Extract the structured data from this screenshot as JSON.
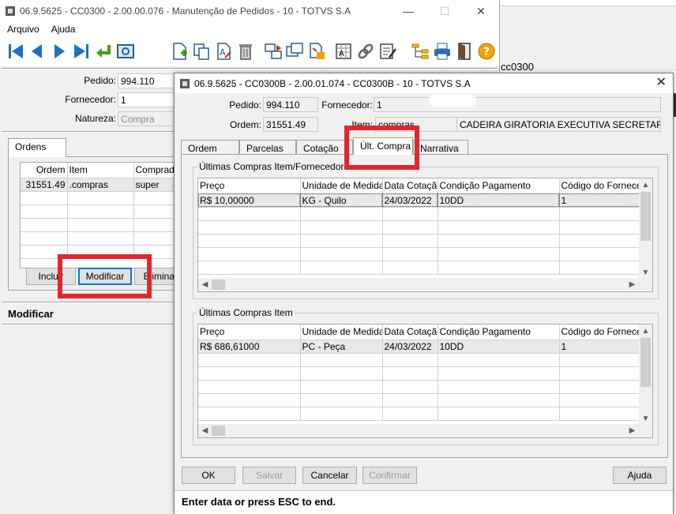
{
  "background_window": {
    "title": "06.9.5625 - CC0300 - 2.00.00.076 - Manutenção de Pedidos - 10 - TOTVS S.A",
    "menu": [
      "Arquivo",
      "Ajuda"
    ],
    "extra_label": "cc0300",
    "fields": {
      "pedido_label": "Pedido:",
      "pedido_value": "994.110",
      "fornecedor_label": "Fornecedor:",
      "fornecedor_value": "1",
      "natureza_label": "Natureza:",
      "natureza_value": "Compra"
    },
    "tab_ordens": "Ordens",
    "grid": {
      "headers": [
        "Ordem",
        "Item",
        "Comprador"
      ],
      "rows": [
        [
          "31551.49",
          ".compras",
          "super"
        ]
      ]
    },
    "buttons": {
      "incluir": "Incluir",
      "modificar": "Modificar",
      "eliminar": "Eliminar"
    },
    "status": "Modificar"
  },
  "dialog": {
    "title": "06.9.5625 - CC0300B - 2.00.01.074 - CC0300B - 10 - TOTVS S.A",
    "fields": {
      "pedido_label": "Pedido:",
      "pedido_value": "994.110",
      "fornecedor_label": "Fornecedor:",
      "fornecedor_value": "1",
      "ordem_label": "Ordem:",
      "ordem_value": "31551.49",
      "item_label": "Item:",
      "item_code": "compras",
      "item_desc": "CADEIRA GIRATORIA EXECUTIVA SECRETARIA C"
    },
    "tabs": [
      "Ordem",
      "Parcelas",
      "Cotação",
      "Últ. Compra",
      "Narrativa"
    ],
    "active_tab": "Últ. Compra",
    "group1": {
      "title": "Últimas Compras Item/Fornecedor",
      "headers": [
        "Preço",
        "Unidade de Medida",
        "Data Cotação",
        "Condição Pagamento",
        "Código do Forneced"
      ],
      "rows": [
        [
          "R$ 10,00000",
          "KG - Quilo",
          "24/03/2022",
          "10DD",
          "1"
        ]
      ]
    },
    "group2": {
      "title": "Últimas Compras Item",
      "headers": [
        "Preço",
        "Unidade de Medida",
        "Data Cotação",
        "Condição Pagamento",
        "Código do Forneced"
      ],
      "rows": [
        [
          "R$ 686,61000",
          "PC - Peça",
          "24/03/2022",
          "10DD",
          "1"
        ]
      ]
    },
    "buttons": {
      "ok": "OK",
      "salvar": "Salvar",
      "cancelar": "Cancelar",
      "confirmar": "Confirmar",
      "ajuda": "Ajuda"
    },
    "status": "Enter data or press ESC to end."
  },
  "colors": {
    "highlight": "#e3262c",
    "toolbar_blue": "#1f6fc8",
    "focus_blue": "#0078d7"
  }
}
